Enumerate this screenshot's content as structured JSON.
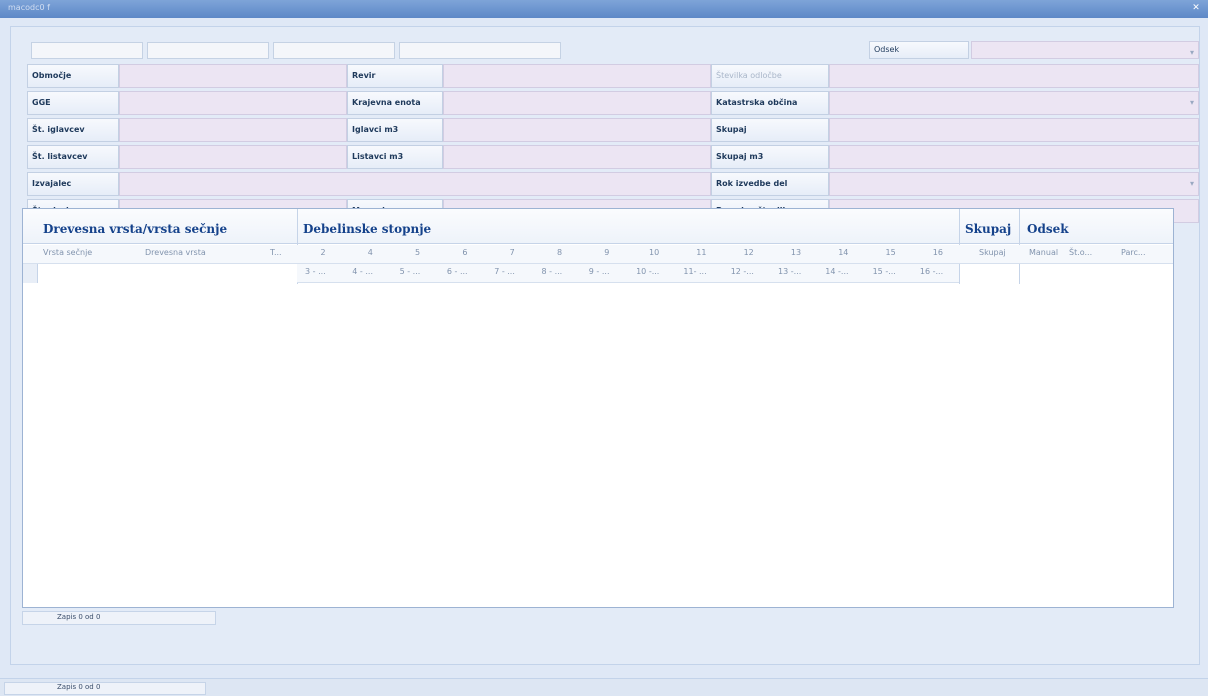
{
  "window": {
    "title": "macodc0 f",
    "close_icon": "close-icon"
  },
  "top": {
    "odsek_label": "Odsek"
  },
  "form": {
    "row1": {
      "a_label": "Območje",
      "b_label": "Revir",
      "c_label": "Številka odločbe"
    },
    "row2": {
      "a_label": "GGE",
      "b_label": "Krajevna enota",
      "c_label": "Katastrska občina"
    },
    "row3": {
      "a_label": "Št. iglavcev",
      "b_label": "Iglavci m3",
      "c_label": "Skupaj"
    },
    "row4": {
      "a_label": "Št. listavcev",
      "b_label": "Listavci m3",
      "c_label": "Skupaj m3"
    },
    "row5": {
      "a_label": "Izvajalec",
      "c_label": "Rok izvedbe del"
    },
    "row6": {
      "a_label": "Št.odseka",
      "b_label": "Manual",
      "c_label": "Parcelna številka"
    }
  },
  "grid": {
    "bands": {
      "vrsta": "Drevesna vrsta/vrsta sečnje",
      "debelinske": "Debelinske stopnje",
      "skupaj": "Skupaj",
      "odsek": "Odsek"
    },
    "cols": {
      "vrsta_secnje": "Vrsta sečnje",
      "drevesna_vrsta": "Drevesna vrsta",
      "t": "T...",
      "skupaj": "Skupaj",
      "manual": "Manual",
      "st_o": "Št.o...",
      "parc": "Parc..."
    },
    "stopnje": [
      "2",
      "4",
      "5",
      "6",
      "7",
      "8",
      "9",
      "10",
      "11",
      "12",
      "13",
      "14",
      "15",
      "16"
    ],
    "stopnje_sub": [
      "3 - ...",
      "4 - ...",
      "5 - ...",
      "6 - ...",
      "7 - ...",
      "8 - ...",
      "9 - ...",
      "10 -...",
      "11- ...",
      "12 -...",
      "13 -...",
      "14 -...",
      "15 -...",
      "16 -..."
    ],
    "nav_text": "Zapis 0 od 0"
  },
  "bottom": {
    "nav_text": "Zapis 0 od 0"
  }
}
